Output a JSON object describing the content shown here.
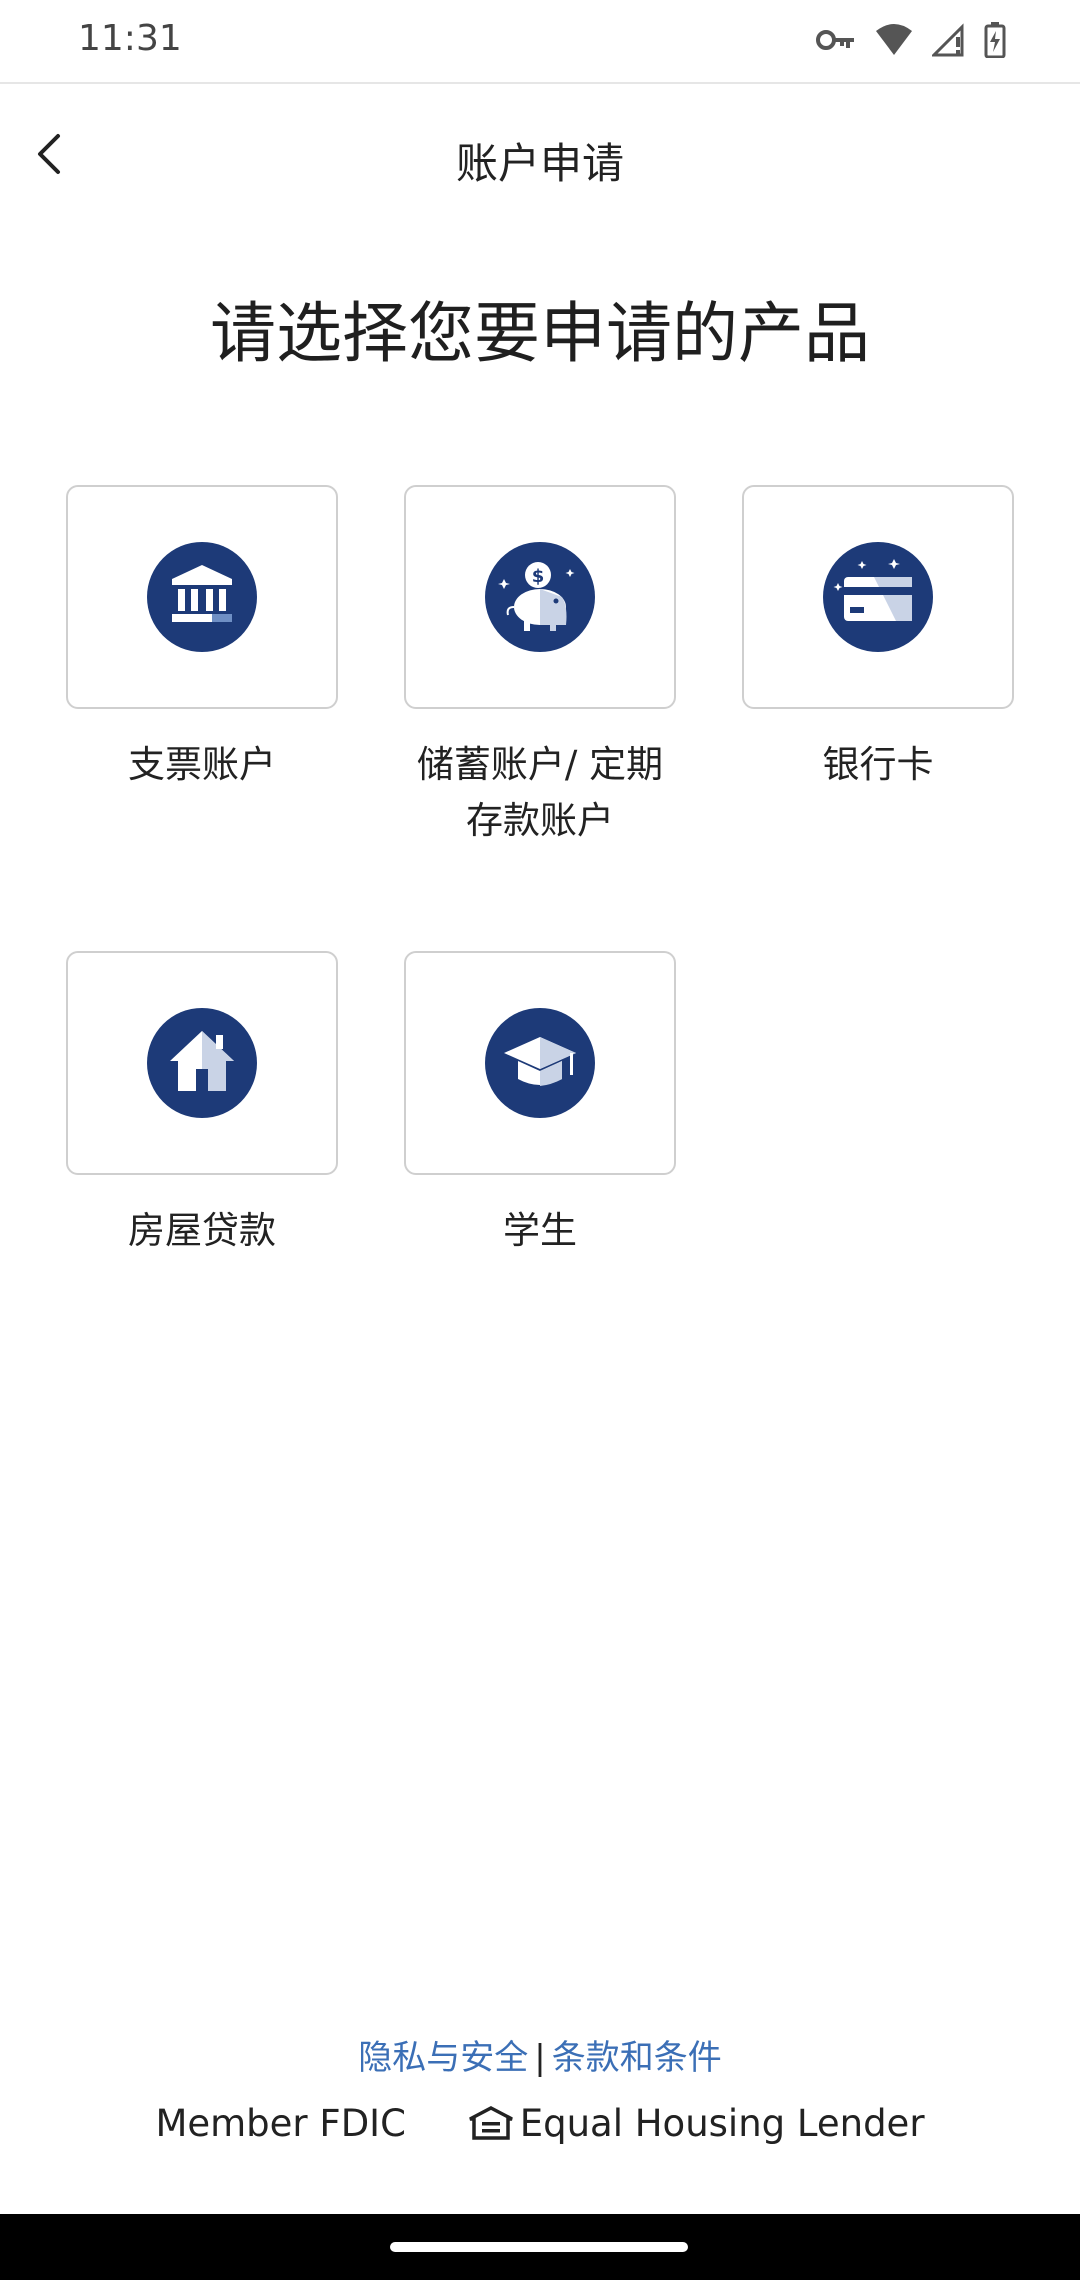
{
  "status_bar": {
    "time": "11:31",
    "icons": [
      "vpn-key-icon",
      "wifi-icon",
      "cell-signal-icon",
      "battery-charging-icon"
    ]
  },
  "nav": {
    "title": "账户申请",
    "back_icon": "chevron-left-icon"
  },
  "heading": "请选择您要申请的产品",
  "products": [
    {
      "label": "支票账户",
      "icon": "bank-icon"
    },
    {
      "label": "储蓄账户/ 定期\n存款账户",
      "icon": "piggy-bank-icon"
    },
    {
      "label": "银行卡",
      "icon": "credit-card-icon"
    },
    {
      "label": "房屋贷款",
      "icon": "house-icon"
    },
    {
      "label": "学生",
      "icon": "graduation-cap-icon"
    }
  ],
  "footer": {
    "privacy_link": "隐私与安全",
    "separator": "|",
    "terms_link": "条款和条件",
    "member_fdic": "Member FDIC",
    "equal_housing": "Equal Housing Lender",
    "equal_housing_icon": "equal-housing-icon"
  },
  "colors": {
    "icon_navy": "#1d3a78",
    "link_blue": "#3b6fb6",
    "card_border": "#cfcfcf"
  }
}
